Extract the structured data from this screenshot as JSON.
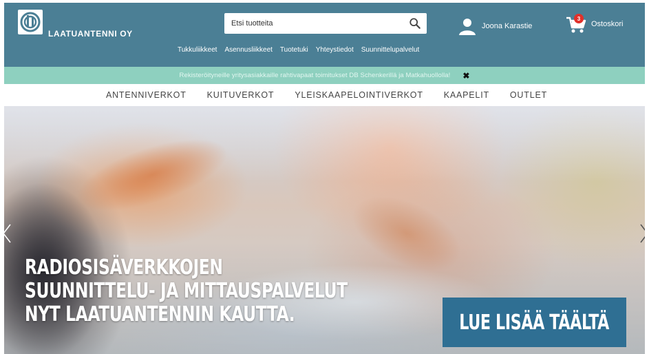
{
  "header": {
    "company_name": "LAATUANTENNI OY",
    "search": {
      "placeholder": "Etsi tuotteita"
    },
    "user_name": "Joona Karastie",
    "cart": {
      "label": "Ostoskori",
      "count": "3"
    },
    "top_links": [
      {
        "label": "Tukkuliikkeet"
      },
      {
        "label": "Asennusliikkeet"
      },
      {
        "label": "Tuotetuki"
      },
      {
        "label": "Yhteystiedot"
      },
      {
        "label": "Suunnittelupalvelut"
      }
    ]
  },
  "notice": {
    "text": "Rekisteröityneille yritysasiakkaille rahtivapaat toimitukset DB Schenkerillä ja Matkahuollolla!",
    "close_symbol": "✖"
  },
  "nav": {
    "items": [
      {
        "label": "ANTENNIVERKOT"
      },
      {
        "label": "KUITUVERKOT"
      },
      {
        "label": "YLEISKAAPELOINTIVERKOT"
      },
      {
        "label": "KAAPELIT"
      },
      {
        "label": "OUTLET"
      }
    ]
  },
  "hero": {
    "headline_lines": [
      "RADIOSISÄVERKKOJEN",
      "SUUNNITTELU- JA MITTAUSPALVELUT",
      "NYT LAATUANTENNIN KAUTTA."
    ],
    "cta_label": "LUE LISÄÄ TÄÄLTÄ"
  },
  "colors": {
    "header_bg": "#4b7f95",
    "notice_bg": "#8ed0bf",
    "cta_bg": "#2f6f93",
    "badge": "#e0312b"
  },
  "icons": {
    "logo": "logo-icon",
    "search": "search-icon",
    "user": "user-icon",
    "cart": "cart-icon",
    "close": "close-icon",
    "prev": "chevron-left-icon",
    "next": "chevron-right-icon"
  }
}
